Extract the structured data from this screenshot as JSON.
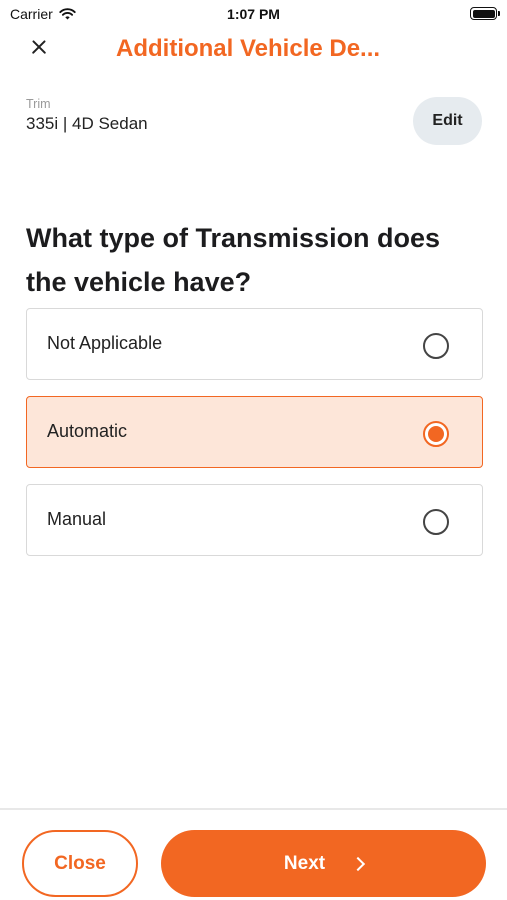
{
  "status_bar": {
    "carrier": "Carrier",
    "time": "1:07 PM",
    "icons": [
      "wifi-icon",
      "battery-icon"
    ]
  },
  "header": {
    "title": "Additional Vehicle De...",
    "close_icon": "close-icon",
    "accent_color": "#f26722"
  },
  "trim": {
    "label": "Trim",
    "value": "335i | 4D Sedan",
    "edit_label": "Edit"
  },
  "question": {
    "text": "What type of Transmission does the vehicle have?"
  },
  "options": [
    {
      "label": "Not Applicable",
      "selected": false
    },
    {
      "label": "Automatic",
      "selected": true
    },
    {
      "label": "Manual",
      "selected": false
    }
  ],
  "footer": {
    "close_label": "Close",
    "next_label": "Next",
    "next_icon": "chevron-right-icon"
  },
  "colors": {
    "accent": "#f26722",
    "selected_background": "#fde6d9",
    "edit_button_background": "#e6ebef"
  }
}
